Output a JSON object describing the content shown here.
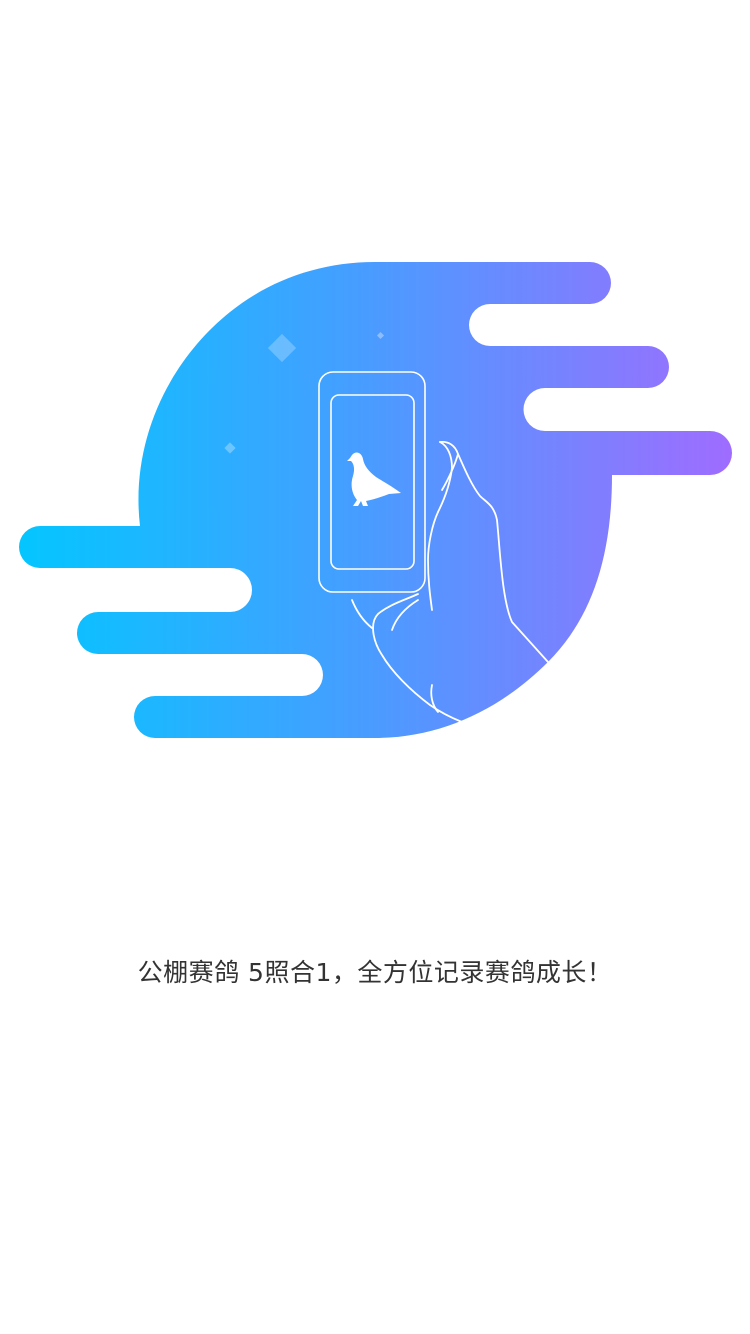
{
  "splash": {
    "tagline": "公棚赛鸽 5照合1，全方位记录赛鸽成长！",
    "illustration_icon": "pigeon-phone-in-hand",
    "gradient_colors": {
      "start": "#00C8FF",
      "mid": "#42A0FF",
      "end": "#A36AFF"
    }
  }
}
